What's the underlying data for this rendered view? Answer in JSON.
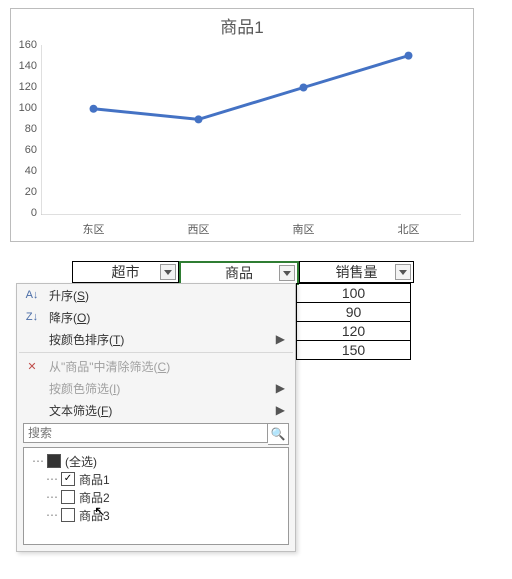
{
  "chart_data": {
    "type": "line",
    "title": "商品1",
    "categories": [
      "东区",
      "西区",
      "南区",
      "北区"
    ],
    "values": [
      100,
      90,
      120,
      150
    ],
    "xlabel": "",
    "ylabel": "",
    "ylim": [
      0,
      160
    ],
    "yticks": [
      0,
      20,
      40,
      60,
      80,
      100,
      120,
      140,
      160
    ],
    "grid": false,
    "series_color": "#4472c4"
  },
  "table": {
    "headers": {
      "col1": "超市",
      "col2": "商品",
      "col3": "销售量"
    },
    "values": [
      "100",
      "90",
      "120",
      "150"
    ]
  },
  "menu": {
    "sort_asc": "升序(",
    "sort_asc_key": "S",
    "sort_asc_tail": ")",
    "sort_desc": "降序(",
    "sort_desc_key": "O",
    "sort_desc_tail": ")",
    "sort_color": "按颜色排序(",
    "sort_color_key": "T",
    "sort_color_tail": ")",
    "clear_filter_pre": "从\"",
    "clear_filter_col": "商品",
    "clear_filter_post": "\"中清除筛选(",
    "clear_filter_key": "C",
    "clear_filter_tail": ")",
    "filter_color": "按颜色筛选(",
    "filter_color_key": "I",
    "filter_color_tail": ")",
    "text_filter": "文本筛选(",
    "text_filter_key": "F",
    "text_filter_tail": ")",
    "search_placeholder": "搜索",
    "icon_az": "A↓",
    "icon_za": "Z↓",
    "icon_clear": "✕",
    "select_all": "(全选)",
    "items": [
      "商品1",
      "商品2",
      "商品3"
    ],
    "selected": [
      true,
      false,
      false
    ]
  },
  "glyphs": {
    "submenu": "▶",
    "search": "🔍",
    "ok": "✓"
  }
}
